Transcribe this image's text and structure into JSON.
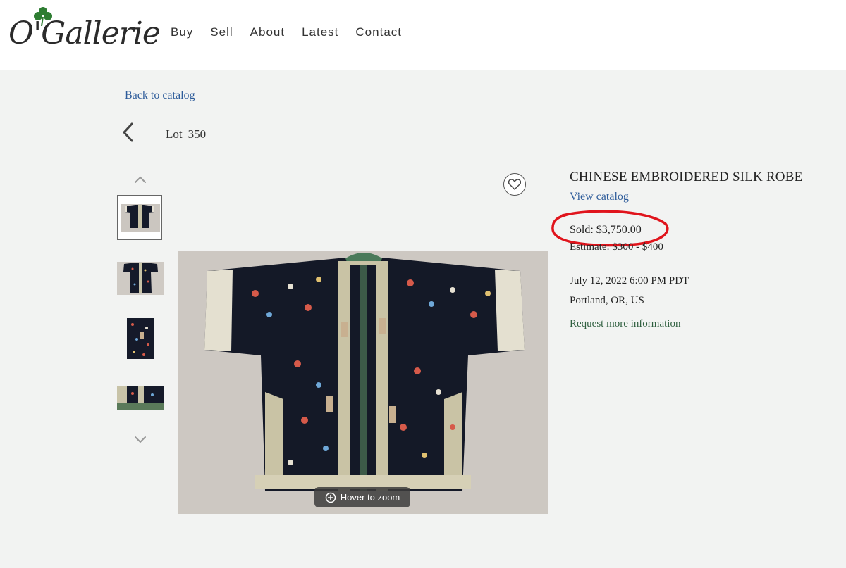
{
  "brand": {
    "logo_text": "O'Gallerie"
  },
  "nav": {
    "items": [
      "Buy",
      "Sell",
      "About",
      "Latest",
      "Contact"
    ]
  },
  "breadcrumb": {
    "back_label": "Back to catalog"
  },
  "lot": {
    "prefix": "Lot",
    "number": "350"
  },
  "item": {
    "title": "CHINESE EMBROIDERED SILK ROBE",
    "view_catalog": "View catalog",
    "sold": "Sold: $3,750.00",
    "estimate": "Estimate: $300 - $400",
    "date": "July 12, 2022 6:00 PM PDT",
    "location": "Portland, OR, US",
    "request_info": "Request more information"
  },
  "image": {
    "zoom_hint": "Hover to zoom"
  },
  "colors": {
    "link_blue": "#2d5b9a",
    "request_green": "#2f5f3f",
    "annotation_red": "#e0141c",
    "page_bg": "#f2f3f2"
  },
  "icons": [
    "shamrock-icon",
    "chevron-left-icon",
    "chevron-up-icon",
    "chevron-down-icon",
    "heart-icon",
    "zoom-icon"
  ]
}
